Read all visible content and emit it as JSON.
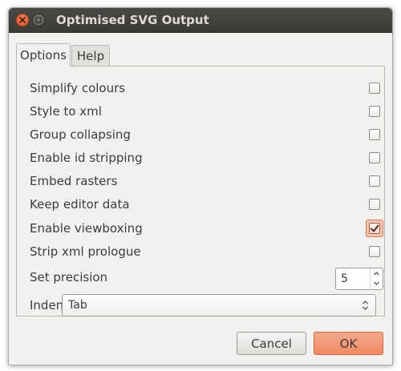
{
  "window": {
    "title": "Optimised SVG Output"
  },
  "tabs": [
    {
      "label": "Options",
      "active": true
    },
    {
      "label": "Help",
      "active": false
    }
  ],
  "options": [
    {
      "label": "Simplify colours",
      "checked": false
    },
    {
      "label": "Style to xml",
      "checked": false
    },
    {
      "label": "Group collapsing",
      "checked": false
    },
    {
      "label": "Enable id stripping",
      "checked": false
    },
    {
      "label": "Embed rasters",
      "checked": false
    },
    {
      "label": "Keep editor data",
      "checked": false
    },
    {
      "label": "Enable viewboxing",
      "checked": true
    },
    {
      "label": "Strip xml prologue",
      "checked": false
    }
  ],
  "precision": {
    "label": "Set precision",
    "value": "5"
  },
  "indent": {
    "label": "Indent",
    "value": "Tab"
  },
  "buttons": {
    "cancel": "Cancel",
    "ok": "OK"
  },
  "icons": {
    "close": "close-icon",
    "minimize": "minimize-icon",
    "check": "check-icon",
    "spin_up": "chevron-up-icon",
    "spin_down": "chevron-down-icon",
    "combo": "updown-chevron-icon"
  },
  "colors": {
    "accent": "#ef8a62",
    "titlebar": "#3b3a36",
    "window_bg": "#f2f1f0"
  }
}
